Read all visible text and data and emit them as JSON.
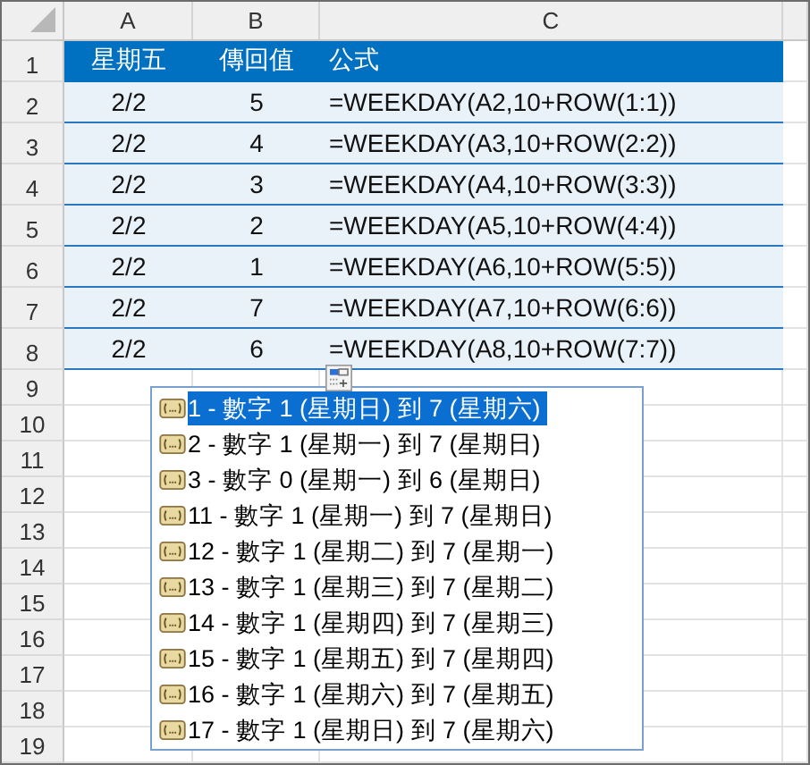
{
  "columns": [
    "A",
    "B",
    "C"
  ],
  "row_numbers": [
    "1",
    "2",
    "3",
    "4",
    "5",
    "6",
    "7",
    "8",
    "9",
    "10",
    "11",
    "12",
    "13",
    "14",
    "15",
    "16",
    "17",
    "18",
    "19"
  ],
  "table": {
    "header": [
      "星期五",
      "傳回值",
      "公式"
    ],
    "rows": [
      [
        "2/2",
        "5",
        "=WEEKDAY(A2,10+ROW(1:1))"
      ],
      [
        "2/2",
        "4",
        "=WEEKDAY(A3,10+ROW(2:2))"
      ],
      [
        "2/2",
        "3",
        "=WEEKDAY(A4,10+ROW(3:3))"
      ],
      [
        "2/2",
        "2",
        "=WEEKDAY(A5,10+ROW(4:4))"
      ],
      [
        "2/2",
        "1",
        "=WEEKDAY(A6,10+ROW(5:5))"
      ],
      [
        "2/2",
        "7",
        "=WEEKDAY(A7,10+ROW(6:6))"
      ],
      [
        "2/2",
        "6",
        "=WEEKDAY(A8,10+ROW(7:7))"
      ]
    ]
  },
  "autocomplete": {
    "items": [
      {
        "label": "1 - 數字 1 (星期日) 到 7 (星期六)",
        "selected": true
      },
      {
        "label": "2 - 數字 1 (星期一) 到 7 (星期日)",
        "selected": false
      },
      {
        "label": "3 - 數字 0 (星期一) 到 6 (星期日)",
        "selected": false
      },
      {
        "label": "11 - 數字 1 (星期一) 到 7 (星期日)",
        "selected": false
      },
      {
        "label": "12 - 數字 1 (星期二) 到 7 (星期一)",
        "selected": false
      },
      {
        "label": "13 - 數字 1 (星期三) 到 7 (星期二)",
        "selected": false
      },
      {
        "label": "14 - 數字 1 (星期四) 到 7 (星期三)",
        "selected": false
      },
      {
        "label": "15 - 數字 1 (星期五) 到 7 (星期四)",
        "selected": false
      },
      {
        "label": "16 - 數字 1 (星期六) 到 7 (星期五)",
        "selected": false
      },
      {
        "label": "17 - 數字 1 (星期日) 到 7 (星期六)",
        "selected": false
      }
    ]
  }
}
